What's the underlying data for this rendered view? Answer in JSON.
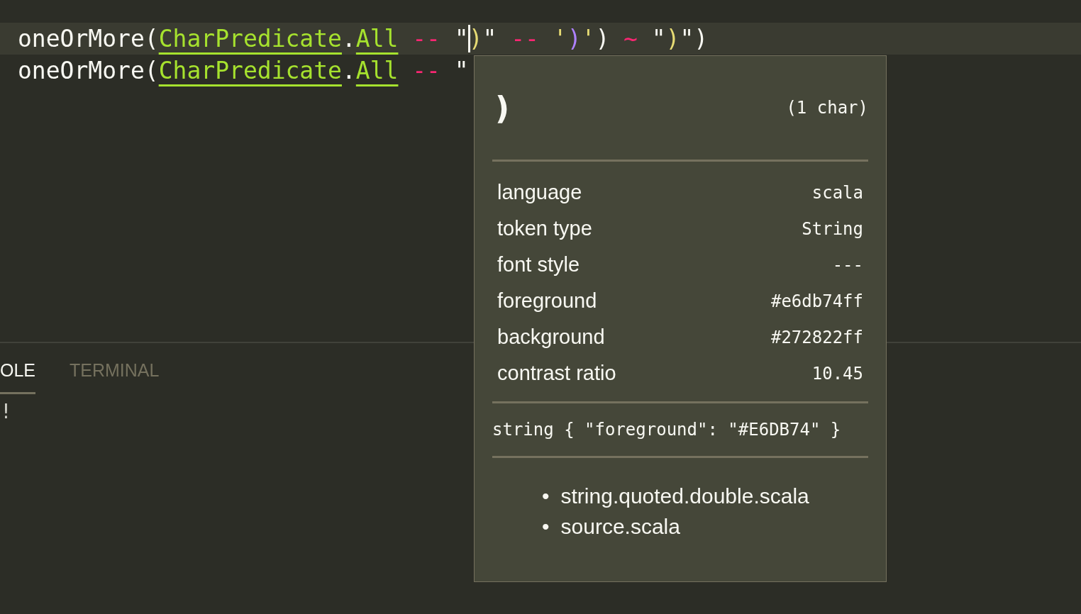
{
  "editor": {
    "lines": [
      {
        "current": true,
        "tokens": [
          {
            "kind": "plain",
            "text": "oneOrMore("
          },
          {
            "kind": "type",
            "text": "CharPredicate"
          },
          {
            "kind": "plain",
            "text": "."
          },
          {
            "kind": "type",
            "text": "All"
          },
          {
            "kind": "operator",
            "text": "--"
          },
          {
            "kind": "quote",
            "text": "\""
          },
          {
            "kind": "string",
            "text": ")",
            "caret_before": true
          },
          {
            "kind": "quote",
            "text": "\""
          },
          {
            "kind": "operator",
            "text": "--"
          },
          {
            "kind": "string",
            "text": "'"
          },
          {
            "kind": "char",
            "text": ")"
          },
          {
            "kind": "string",
            "text": "'"
          },
          {
            "kind": "plain",
            "text": ")"
          },
          {
            "kind": "operator",
            "text": "~"
          },
          {
            "kind": "quote",
            "text": "\""
          },
          {
            "kind": "string",
            "text": ")"
          },
          {
            "kind": "quote",
            "text": "\""
          },
          {
            "kind": "plain",
            "text": ")"
          }
        ]
      },
      {
        "current": false,
        "tokens": [
          {
            "kind": "plain",
            "text": "oneOrMore("
          },
          {
            "kind": "type",
            "text": "CharPredicate"
          },
          {
            "kind": "plain",
            "text": "."
          },
          {
            "kind": "type",
            "text": "All"
          },
          {
            "kind": "operator",
            "text": "--"
          },
          {
            "kind": "quote",
            "text": "\""
          }
        ]
      }
    ]
  },
  "panel": {
    "tabs": [
      {
        "label": "OLE",
        "selected": true
      },
      {
        "label": "TERMINAL",
        "selected": false
      }
    ],
    "output": "!"
  },
  "inspector": {
    "glyph": ")",
    "char_count": "(1 char)",
    "rows": [
      {
        "label": "language",
        "value": "scala"
      },
      {
        "label": "token type",
        "value": "String"
      },
      {
        "label": "font style",
        "value": "---"
      },
      {
        "label": "foreground",
        "value": "#e6db74ff"
      },
      {
        "label": "background",
        "value": "#272822ff"
      },
      {
        "label": "contrast ratio",
        "value": "10.45"
      }
    ],
    "rule": "string { \"foreground\": \"#E6DB74\" }",
    "scopes": [
      {
        "marker": "•",
        "text": "string.quoted.double.scala"
      },
      {
        "marker": "•",
        "text": "source.scala"
      }
    ]
  }
}
